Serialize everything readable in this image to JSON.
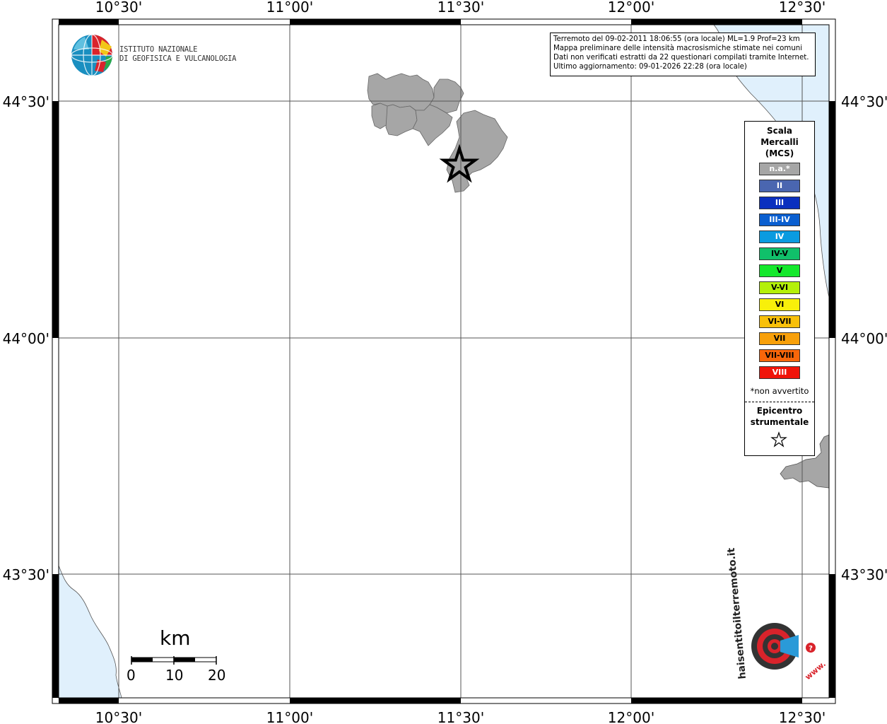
{
  "map": {
    "lon_labels_top": [
      "10°30'",
      "11°00'",
      "11°30'",
      "12°00'",
      "12°30'"
    ],
    "lon_labels_bottom": [
      "10°30'",
      "11°00'",
      "11°30'",
      "12°00'",
      "12°30'"
    ],
    "lat_labels_left": [
      "44°30'",
      "44°00'",
      "43°30'"
    ],
    "lat_labels_right": [
      "44°30'",
      "44°00'",
      "43°30'"
    ],
    "sea_color": "#e0f0fc",
    "land_na_color": "#a6a6a6"
  },
  "logo": {
    "line1": "ISTITUTO NAZIONALE",
    "line2": "DI GEOFISICA E VULCANOLOGIA"
  },
  "info": {
    "line1": "Terremoto del 09-02-2011 18:06:55 (ora locale) ML=1.9 Prof=23 km",
    "line2": "Mappa preliminare delle intensità macrosismiche stimate nei comuni",
    "line3": "Dati non verificati estratti da 22 questionari compilati tramite Internet.",
    "line4": "Ultimo aggiornamento: 09-01-2026 22:28 (ora locale)"
  },
  "legend": {
    "title1": "Scala",
    "title2": "Mercalli",
    "title3": "(MCS)",
    "items": [
      {
        "label": "n.a.*",
        "color": "#a6a6a6",
        "text_color": "#ffffff"
      },
      {
        "label": "II",
        "color": "#4a66b0",
        "text_color": "#ffffff"
      },
      {
        "label": "III",
        "color": "#0a2fbf",
        "text_color": "#ffffff"
      },
      {
        "label": "III-IV",
        "color": "#0a5fd0",
        "text_color": "#ffffff"
      },
      {
        "label": "IV",
        "color": "#0a9be0",
        "text_color": "#ffffff"
      },
      {
        "label": "IV-V",
        "color": "#10c06a",
        "text_color": "#000000"
      },
      {
        "label": "V",
        "color": "#14e82c",
        "text_color": "#000000"
      },
      {
        "label": "V-VI",
        "color": "#b4f00a",
        "text_color": "#000000"
      },
      {
        "label": "VI",
        "color": "#f8f00a",
        "text_color": "#000000"
      },
      {
        "label": "VI-VII",
        "color": "#f8c00a",
        "text_color": "#000000"
      },
      {
        "label": "VII",
        "color": "#f8a00a",
        "text_color": "#000000"
      },
      {
        "label": "VII-VIII",
        "color": "#f8660a",
        "text_color": "#000000"
      },
      {
        "label": "VIII",
        "color": "#f0140a",
        "text_color": "#ffffff"
      }
    ],
    "note": "*non avvertito",
    "epi1": "Epicentro",
    "epi2": "strumentale"
  },
  "scale_bar": {
    "unit": "km",
    "ticks": [
      "0",
      "10",
      "20"
    ]
  },
  "badge": {
    "text": "haisentitoilterremoto.it",
    "prefix": "www.",
    "question": "?"
  }
}
